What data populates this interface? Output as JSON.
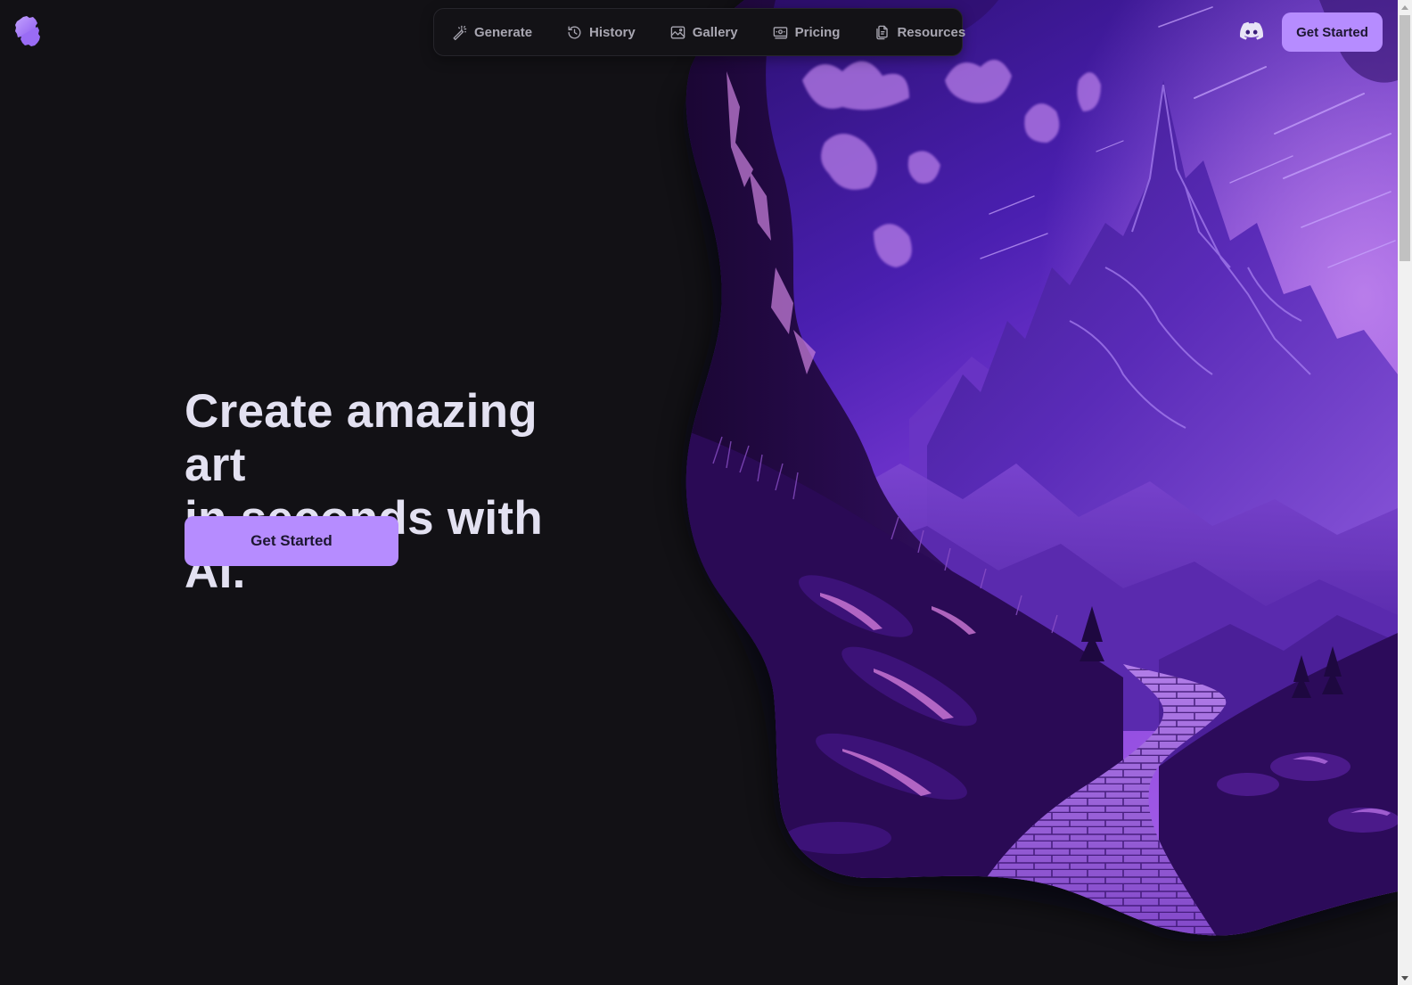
{
  "brand": {
    "name": "logo",
    "accent": "#b68cff",
    "background": "#121115"
  },
  "nav": {
    "items": [
      {
        "label": "Generate",
        "icon": "magic-wand-icon"
      },
      {
        "label": "History",
        "icon": "history-icon"
      },
      {
        "label": "Gallery",
        "icon": "image-icon"
      },
      {
        "label": "Pricing",
        "icon": "banknote-icon"
      },
      {
        "label": "Resources",
        "icon": "documents-icon"
      }
    ]
  },
  "header": {
    "discord_icon": "discord-icon",
    "cta_label": "Get Started"
  },
  "hero": {
    "headline_line1": "Create amazing art",
    "headline_line2": "in seconds with AI.",
    "cta_label": "Get Started",
    "image_alt": "purple fantasy mountain landscape with stone path"
  }
}
